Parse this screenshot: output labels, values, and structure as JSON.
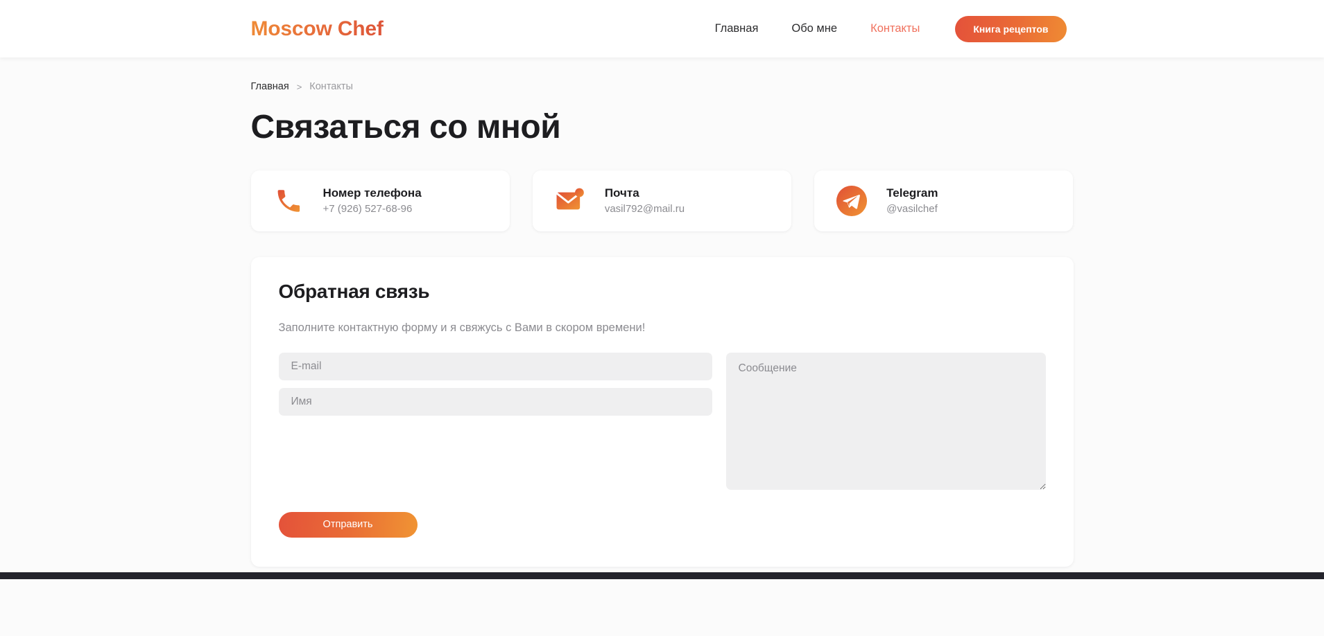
{
  "header": {
    "logo": "Moscow Chef",
    "nav": [
      {
        "label": "Главная",
        "active": false
      },
      {
        "label": "Обо мне",
        "active": false
      },
      {
        "label": "Контакты",
        "active": true
      }
    ],
    "cta_label": "Книга рецептов"
  },
  "breadcrumb": {
    "home": "Главная",
    "separator": ">",
    "current": "Контакты"
  },
  "page": {
    "title": "Связаться со мной"
  },
  "contacts": [
    {
      "icon": "phone-icon",
      "title": "Номер телефона",
      "value": "+7 (926) 527-68-96"
    },
    {
      "icon": "envelope-icon",
      "title": "Почта",
      "value": "vasil792@mail.ru"
    },
    {
      "icon": "telegram-icon",
      "title": "Telegram",
      "value": "@vasilchef"
    }
  ],
  "form": {
    "title": "Обратная связь",
    "subtitle": "Заполните контактную форму и я свяжусь с Вами в скором времени!",
    "email_placeholder": "E-mail",
    "email_value": "",
    "name_placeholder": "Имя",
    "name_value": "",
    "message_placeholder": "Сообщение",
    "message_value": "",
    "submit_label": "Отправить"
  },
  "colors": {
    "accent_start": "#e4523a",
    "accent_end": "#f09433",
    "active_link": "#f0705c",
    "page_background": "#fbfbfb",
    "card_background": "#ffffff",
    "field_background": "#efeff0",
    "muted_text": "#8b8b90",
    "footer": "#24242c"
  }
}
